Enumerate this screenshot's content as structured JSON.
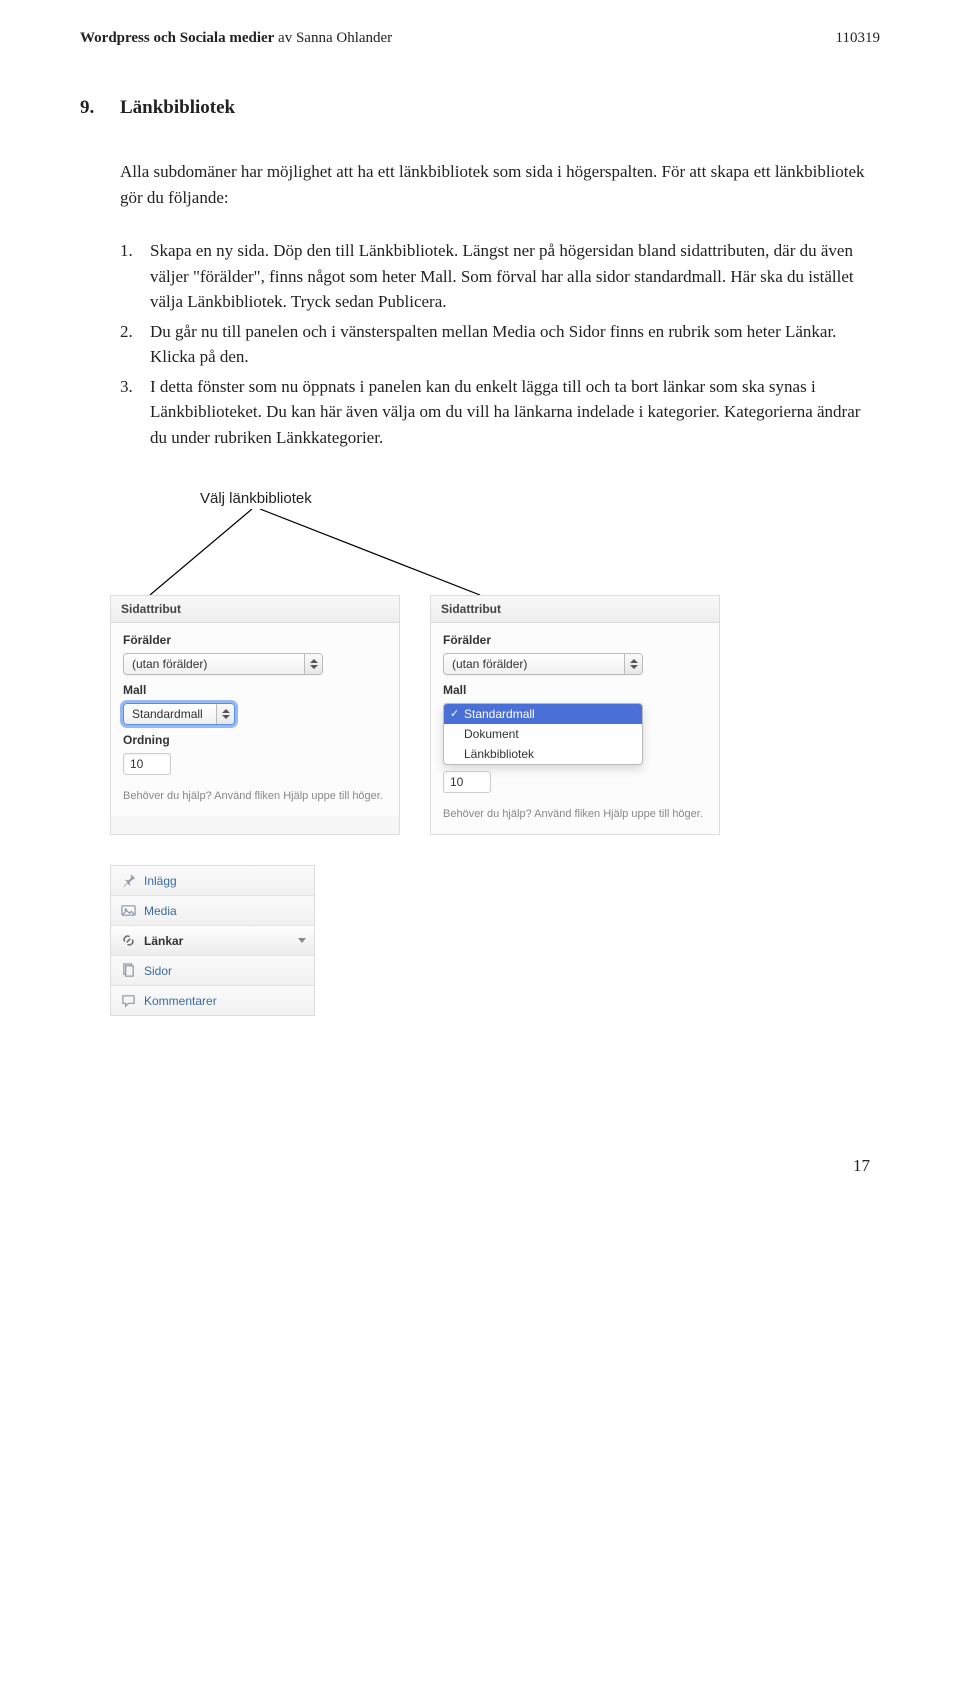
{
  "header": {
    "title_bold": "Wordpress och Sociala medier",
    "title_by": " av Sanna Ohlander",
    "date": "110319"
  },
  "section": {
    "number": "9.",
    "title": "Länkbibliotek"
  },
  "intro": "Alla subdomäner har möjlighet att ha ett länkbibliotek som sida i högerspalten. För att skapa ett länkbibliotek gör du följande:",
  "steps": [
    "Skapa en ny sida. Döp den till Länkbibliotek. Längst ner på högersidan bland sidattributen, där du även väljer \"förälder\", finns något som heter Mall. Som förval har alla sidor standardmall. Här ska du istället välja Länkbibliotek. Tryck sedan Publicera.",
    "Du går nu till panelen och i vänsterspalten mellan Media och Sidor finns en rubrik som heter Länkar. Klicka på den.",
    "I detta fönster som nu öppnats i panelen kan du enkelt lägga till och ta bort länkar som ska synas i Länkbiblioteket. Du kan här även välja om du vill ha länkarna indelade i kategorier. Kategorierna ändrar du under rubriken Länkkategorier."
  ],
  "caption": "Välj länkbibliotek",
  "panel": {
    "title": "Sidattribut",
    "parent_label": "Förälder",
    "parent_value": "(utan förälder)",
    "mall_label": "Mall",
    "mall_value": "Standardmall",
    "order_label": "Ordning",
    "order_value": "10",
    "help_text": "Behöver du hjälp? Använd fliken Hjälp uppe till höger.",
    "options": [
      "Standardmall",
      "Dokument",
      "Länkbibliotek"
    ]
  },
  "nav": {
    "items": [
      {
        "label": "Inlägg",
        "icon": "pin"
      },
      {
        "label": "Media",
        "icon": "media"
      },
      {
        "label": "Länkar",
        "icon": "link",
        "active": true
      },
      {
        "label": "Sidor",
        "icon": "pages"
      },
      {
        "label": "Kommentarer",
        "icon": "comments"
      }
    ]
  },
  "page_number": "17"
}
